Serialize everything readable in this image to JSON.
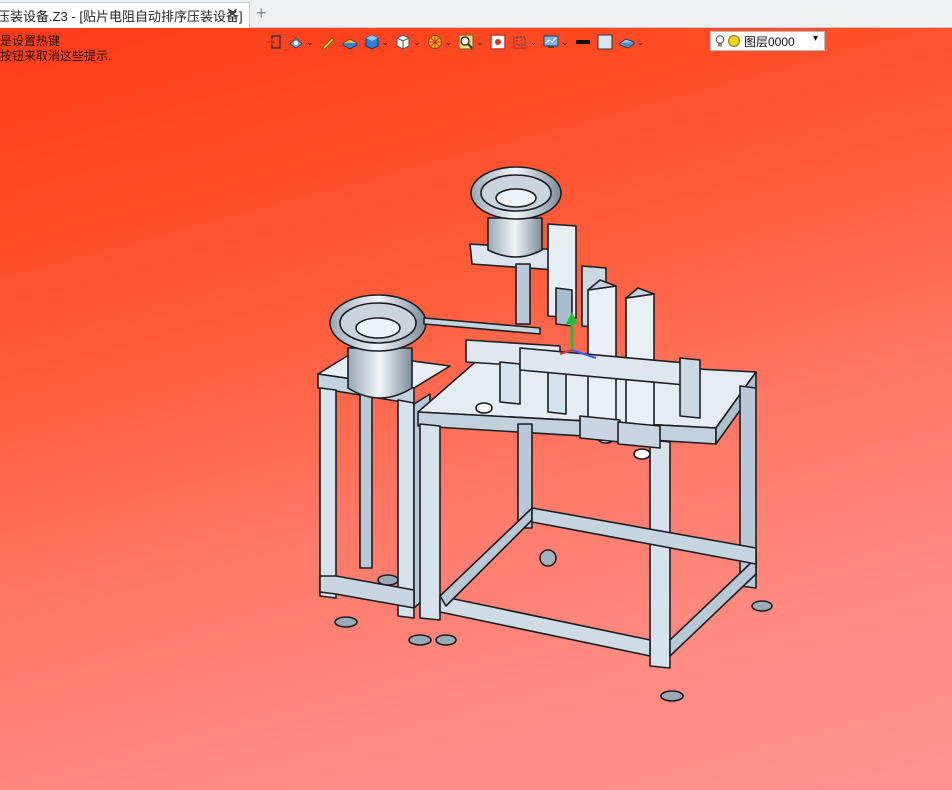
{
  "tab": {
    "title": "压装设备.Z3 - [贴片电阻自动排序压装设备]",
    "close": "✕",
    "add": "+"
  },
  "hint": {
    "line1": "是设置热键",
    "line2": "按钮来取消这些提示."
  },
  "toolbar": {
    "icons": [
      "exit-icon",
      "view-orient-icon",
      "pen-icon",
      "shade-icon",
      "cube-blue-icon",
      "cube-white-icon",
      "render-icon",
      "zoom-icon",
      "section-icon",
      "box-icon",
      "display-icon",
      "color-black-icon",
      "color-light-icon",
      "plane-icon"
    ]
  },
  "layer": {
    "label": "图层0000",
    "arrow": "▾"
  },
  "colors": {
    "bg_top": "#ff3b1a",
    "bg_bottom": "#ff9290",
    "frame": "#d4e0ea",
    "frame_dark": "#8ea4b6"
  }
}
